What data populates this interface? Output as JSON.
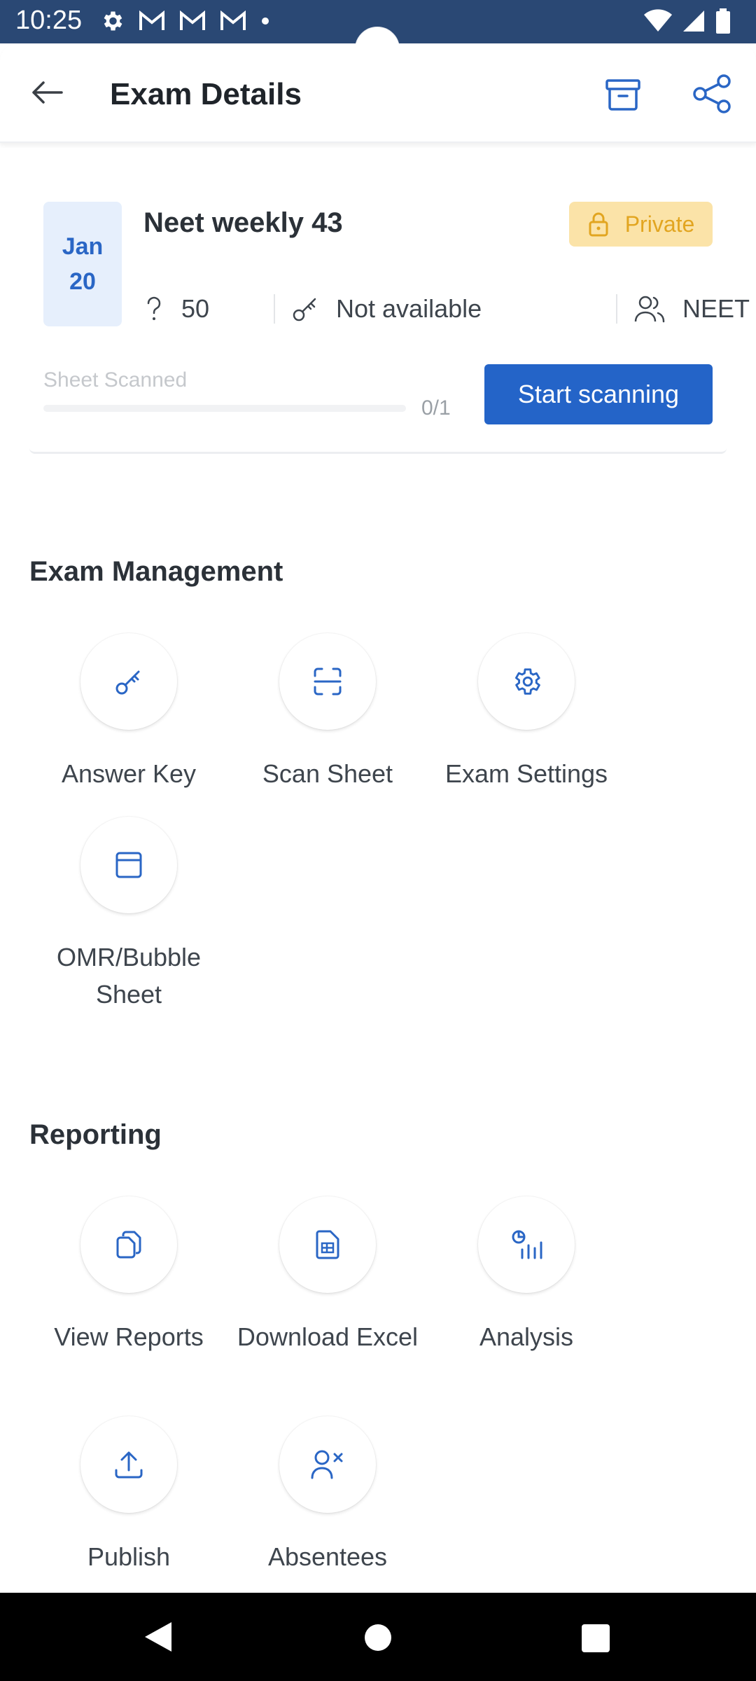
{
  "status_bar": {
    "time": "10:25",
    "left_icons": [
      "settings-icon",
      "gmail-icon",
      "gmail-icon",
      "gmail-icon",
      "dot-icon"
    ],
    "right_icons": [
      "wifi-icon",
      "signal-icon",
      "battery-icon"
    ]
  },
  "app_bar": {
    "title": "Exam Details",
    "back_icon": "arrow-left-icon",
    "archive_icon": "archive-icon",
    "share_icon": "share-icon"
  },
  "exam": {
    "date_month": "Jan",
    "date_day": "20",
    "name": "Neet weekly 43",
    "visibility": "Private",
    "question_count": "50",
    "answer_key_status": "Not available",
    "group": "NEET",
    "sheet_scanned_label": "Sheet Scanned",
    "sheet_scanned_count": "0/1",
    "sheet_scanned_fraction": 0,
    "start_button": "Start scanning"
  },
  "exam_management": {
    "title": "Exam Management",
    "tiles": [
      {
        "label": "Answer Key",
        "icon": "key-icon"
      },
      {
        "label": "Scan Sheet",
        "icon": "scan-icon"
      },
      {
        "label": "Exam Settings",
        "icon": "gear-icon"
      },
      {
        "label": "OMR/Bubble Sheet",
        "icon": "sheet-icon"
      }
    ]
  },
  "reporting": {
    "title": "Reporting",
    "tiles": [
      {
        "label": "View Reports",
        "icon": "copy-icon"
      },
      {
        "label": "Download Excel",
        "icon": "excel-icon"
      },
      {
        "label": "Analysis",
        "icon": "analysis-icon"
      },
      {
        "label": "Publish",
        "icon": "upload-icon"
      },
      {
        "label": "Absentees",
        "icon": "user-remove-icon"
      }
    ]
  },
  "colors": {
    "primary": "#2464c8",
    "status_bar": "#2a4874",
    "private_badge_bg": "#fbe3a8",
    "private_badge_text": "#e2a520",
    "date_box_bg": "#e6effc"
  }
}
